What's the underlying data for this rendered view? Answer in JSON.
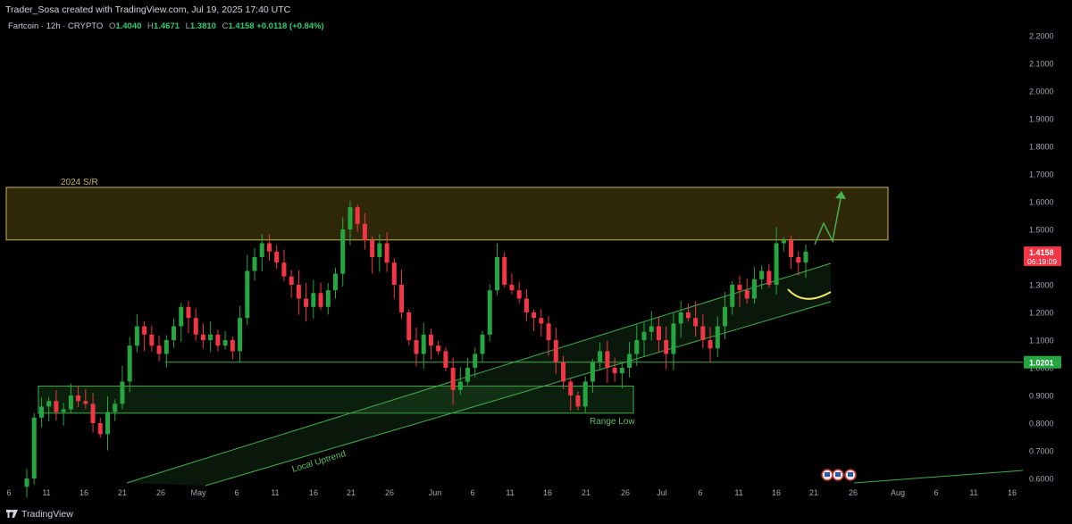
{
  "header": {
    "caption": "Trader_Sosa created with TradingView.com, Jul 19, 2025 17:40 UTC"
  },
  "legend": {
    "symbol": "Fartcoin · 12h · CRYPTO",
    "open_label": "O",
    "open": "1.4040",
    "high_label": "H",
    "high": "1.4671",
    "low_label": "L",
    "low": "1.3810",
    "close_label": "C",
    "close": "1.4158",
    "change": "+0.0118 (+0.84%)"
  },
  "footer": {
    "brand": "TradingView"
  },
  "chart_data": {
    "type": "candlestick",
    "symbol": "Fartcoin",
    "interval": "12h",
    "ylim": [
      0.58,
      2.24
    ],
    "y_ticks": [
      "0.6000",
      "0.7000",
      "0.8000",
      "0.9000",
      "1.0000",
      "1.1000",
      "1.2000",
      "1.3000",
      "1.4000",
      "1.5000",
      "1.6000",
      "1.7000",
      "1.8000",
      "1.9000",
      "2.0000",
      "2.1000",
      "2.2000"
    ],
    "x_ticks": [
      "6",
      "11",
      "16",
      "21",
      "26",
      "May",
      "6",
      "11",
      "16",
      "21",
      "26",
      "Jun",
      "6",
      "11",
      "16",
      "21",
      "26",
      "Jul",
      "6",
      "11",
      "16",
      "21",
      "26",
      "Aug",
      "6",
      "11",
      "16"
    ],
    "price_label": {
      "value": "1.4158",
      "countdown": "06:19:09",
      "color": "#f23645"
    },
    "level_label": {
      "value": "1.0201",
      "color": "#26a641"
    },
    "colors": {
      "up": "#26a641",
      "down": "#f23645",
      "zone": "#c9b458",
      "channel": "#3fae4a",
      "curve": "#f5e663",
      "arrow": "#4caf50"
    },
    "annotations": [
      "2024 S/R",
      "Range Low",
      "Local Uptrend"
    ],
    "zones": [
      {
        "name": "2024 S/R",
        "from": 1.462,
        "to": 1.652,
        "color": "#c9b458"
      },
      {
        "name": "Range Low",
        "from": 0.836,
        "to": 0.934,
        "color": "#3fae4a"
      }
    ],
    "horizontal_line": 1.0201,
    "close_series": [
      0.6,
      0.82,
      0.86,
      0.88,
      0.84,
      0.85,
      0.9,
      0.88,
      0.87,
      0.8,
      0.76,
      0.84,
      0.87,
      0.95,
      1.08,
      1.15,
      1.12,
      1.08,
      1.05,
      1.1,
      1.15,
      1.22,
      1.18,
      1.12,
      1.1,
      1.12,
      1.08,
      1.1,
      1.06,
      1.18,
      1.35,
      1.4,
      1.45,
      1.42,
      1.38,
      1.33,
      1.3,
      1.25,
      1.22,
      1.27,
      1.22,
      1.28,
      1.34,
      1.5,
      1.58,
      1.52,
      1.46,
      1.4,
      1.45,
      1.38,
      1.3,
      1.2,
      1.1,
      1.05,
      1.12,
      1.08,
      1.06,
      1.0,
      0.92,
      0.95,
      1.0,
      1.05,
      1.12,
      1.28,
      1.4,
      1.3,
      1.28,
      1.25,
      1.2,
      1.18,
      1.16,
      1.1,
      1.02,
      0.95,
      0.9,
      0.86,
      0.95,
      1.02,
      1.06,
      1.0,
      0.98,
      1.0,
      1.05,
      1.1,
      1.13,
      1.15,
      1.1,
      1.05,
      1.16,
      1.2,
      1.18,
      1.15,
      1.1,
      1.07,
      1.15,
      1.22,
      1.3,
      1.28,
      1.25,
      1.32,
      1.35,
      1.3,
      1.45,
      1.46,
      1.4,
      1.38,
      1.42
    ]
  }
}
